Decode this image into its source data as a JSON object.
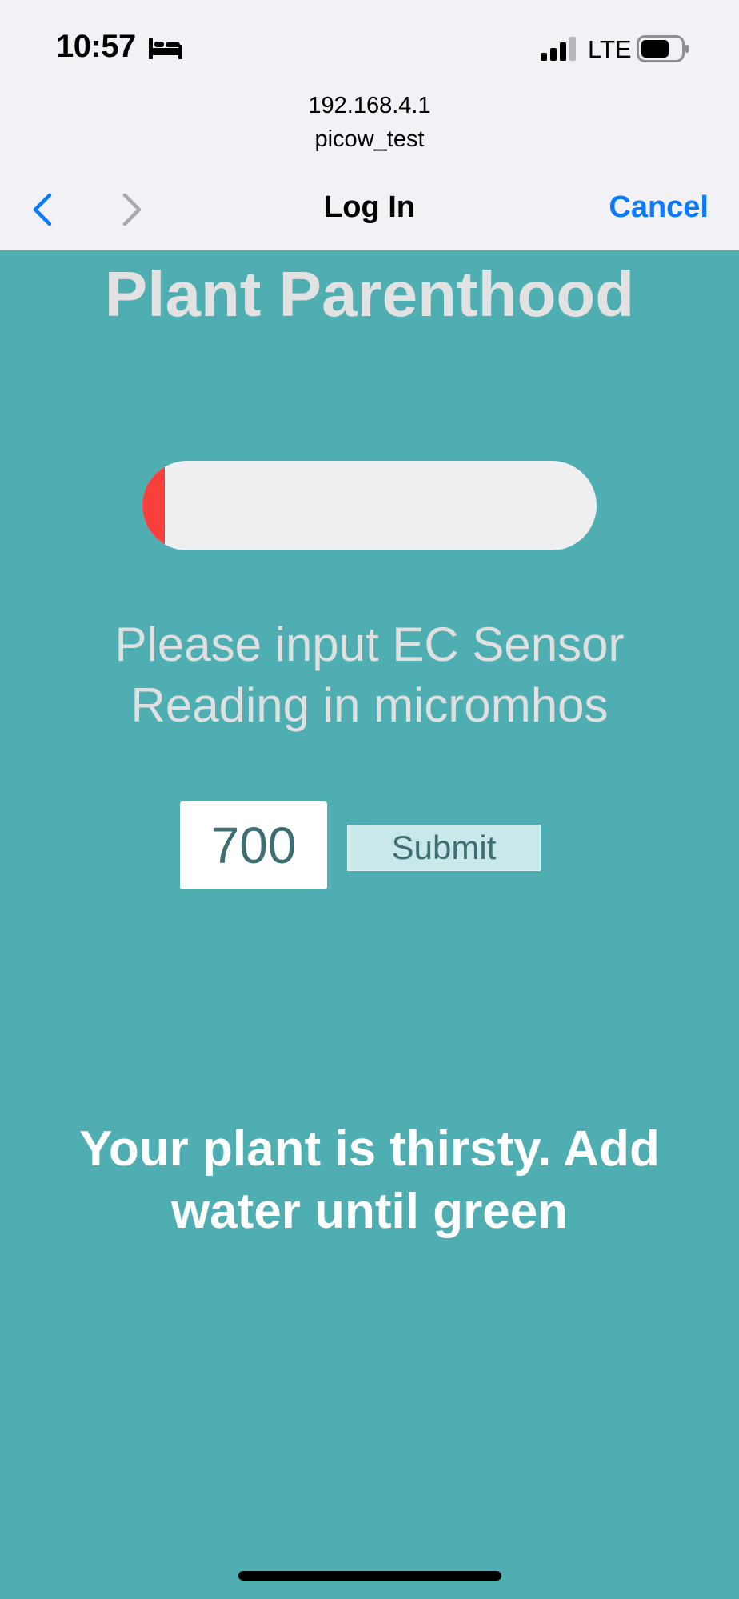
{
  "status_bar": {
    "time": "10:57",
    "network": "LTE",
    "icons": [
      "bed-icon",
      "signal-icon",
      "battery-icon"
    ]
  },
  "browser": {
    "host": "192.168.4.1",
    "ssid": "picow_test",
    "title": "Log In",
    "cancel_label": "Cancel",
    "back_icon": "chevron-left-icon",
    "forward_icon": "chevron-right-icon"
  },
  "page": {
    "title": "Plant Parenthood",
    "meter": {
      "level": 0.05,
      "fill_color": "#F9403A",
      "track_color": "#EFEFF1"
    },
    "prompt": "Please input EC Sensor Reading in micromhos",
    "input_value": "700",
    "submit_label": "Submit",
    "status_message": "Your plant is thirsty. Add water until green"
  },
  "colors": {
    "background": "#4EAEB1",
    "accent": "#0A7AFF"
  }
}
